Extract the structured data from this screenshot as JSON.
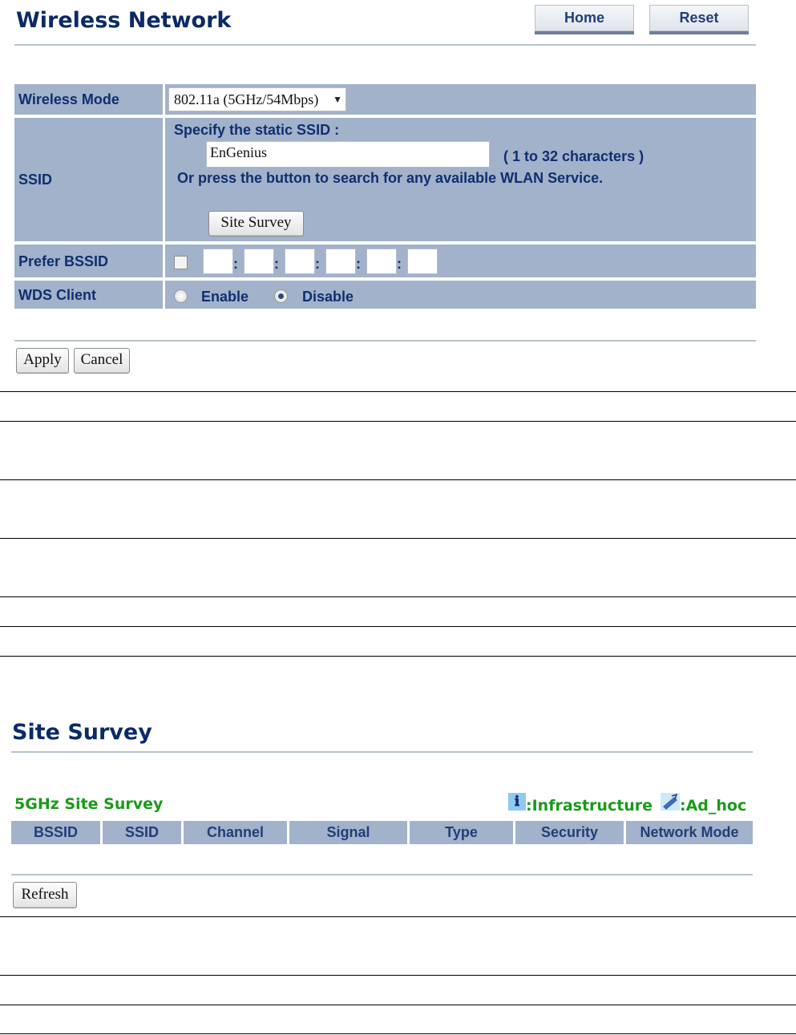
{
  "wireless": {
    "title": "Wireless Network",
    "home_label": "Home",
    "reset_label": "Reset",
    "mode_label": "Wireless Mode",
    "mode_value": "802.11a (5GHz/54Mbps)",
    "ssid_label": "SSID",
    "ssid_specify": "Specify the static SSID  :",
    "ssid_value": "EnGenius",
    "ssid_hint": "( 1 to 32 characters )",
    "ssid_or": "Or press the button to search for any available WLAN Service.",
    "site_survey_button": "Site Survey",
    "prefer_bssid_label": "Prefer BSSID",
    "bssid_separator": ":",
    "wds_label": "WDS Client",
    "wds_enable": "Enable",
    "wds_disable": "Disable",
    "wds_selected": "Disable",
    "apply_label": "Apply",
    "cancel_label": "Cancel"
  },
  "survey": {
    "title": "Site Survey",
    "subtitle": "5GHz Site Survey",
    "legend_infra": ":Infrastructure",
    "legend_adhoc": ":Ad_hoc",
    "infra_icon": "info-i-icon",
    "adhoc_icon": "wireless-card-icon",
    "columns": [
      "BSSID",
      "SSID",
      "Channel",
      "Signal",
      "Type",
      "Security",
      "Network Mode"
    ],
    "refresh_label": "Refresh"
  },
  "colors": {
    "header_text": "#0b2a66",
    "row_bg": "#a2b2ca",
    "survey_green": "#1a9a1a"
  }
}
